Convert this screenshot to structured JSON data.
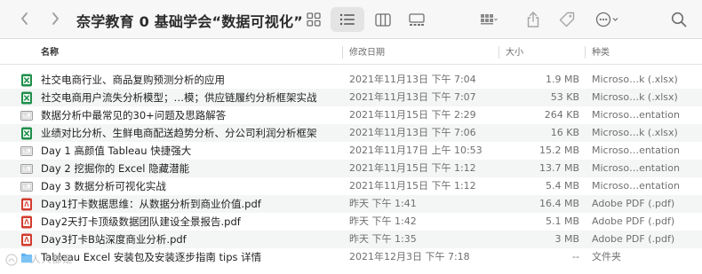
{
  "window": {
    "title": "奈学教育 0 基础学会“数据可视化”"
  },
  "toolbar": {
    "back_icon": "chevron-left-icon",
    "forward_icon": "chevron-right-icon",
    "view_modes": [
      "icon-view",
      "list-view",
      "column-view",
      "gallery-view"
    ],
    "active_view": "list-view"
  },
  "columns": {
    "name": "名称",
    "date": "修改日期",
    "size": "大小",
    "kind": "种类"
  },
  "files": [
    {
      "name": "社交电商行业、商品复购预测分析的应用",
      "date": "2021年11月13日 下午 7:04",
      "size": "1.9 MB",
      "kind": "Microso…k (.xlsx)",
      "icon": "excel"
    },
    {
      "name": "社交电商用户流失分析模型；…模；供应链履约分析框架实战",
      "date": "2021年11月13日 下午 7:07",
      "size": "53 KB",
      "kind": "Microso…k (.xlsx)",
      "icon": "excel"
    },
    {
      "name": "数据分析中最常见的30+问题及思路解答",
      "date": "2021年11月15日 下午 2:29",
      "size": "264 KB",
      "kind": "Microso…entation",
      "icon": "pptx"
    },
    {
      "name": "业绩对比分析、生鲜电商配送趋势分析、分公司利润分析框架",
      "date": "2021年11月13日 下午 7:06",
      "size": "16 KB",
      "kind": "Microso…k (.xlsx)",
      "icon": "excel"
    },
    {
      "name": "Day 1 高颜值 Tableau 快捷强大",
      "date": "2021年11月17日 上午 10:53",
      "size": "15.2 MB",
      "kind": "Microso…entation",
      "icon": "pptx"
    },
    {
      "name": "Day 2 挖掘你的 Excel 隐藏潜能",
      "date": "2021年11月15日 下午 1:12",
      "size": "13.7 MB",
      "kind": "Microso…entation",
      "icon": "pptx"
    },
    {
      "name": "Day 3 数据分析可视化实战",
      "date": "2021年11月15日 下午 1:12",
      "size": "5.4 MB",
      "kind": "Microso…entation",
      "icon": "pptx"
    },
    {
      "name": "Day1打卡数据思维：从数据分析到商业价值.pdf",
      "date": "昨天 下午 1:41",
      "size": "16.4 MB",
      "kind": "Adobe PDF (.pdf)",
      "icon": "pdf"
    },
    {
      "name": "Day2天打卡顶级数据团队建设全景报告.pdf",
      "date": "昨天 下午 1:42",
      "size": "5.1 MB",
      "kind": "Adobe PDF (.pdf)",
      "icon": "pdf"
    },
    {
      "name": "Day3打卡B站深度商业分析.pdf",
      "date": "昨天 下午 1:35",
      "size": "3 MB",
      "kind": "Adobe PDF (.pdf)",
      "icon": "pdf"
    },
    {
      "name": "Tableau Excel 安装包及安装逐步指南 tips 详情",
      "date": "2021年12月3日 下午 7:18",
      "size": "--",
      "kind": "文件夹",
      "icon": "folder"
    }
  ],
  "watermark": "人人都是",
  "colors": {
    "excel": "#1f8f4a",
    "pdf": "#d23b2e",
    "folder": "#5ab1ef",
    "pptx": "#9a9a9a"
  }
}
